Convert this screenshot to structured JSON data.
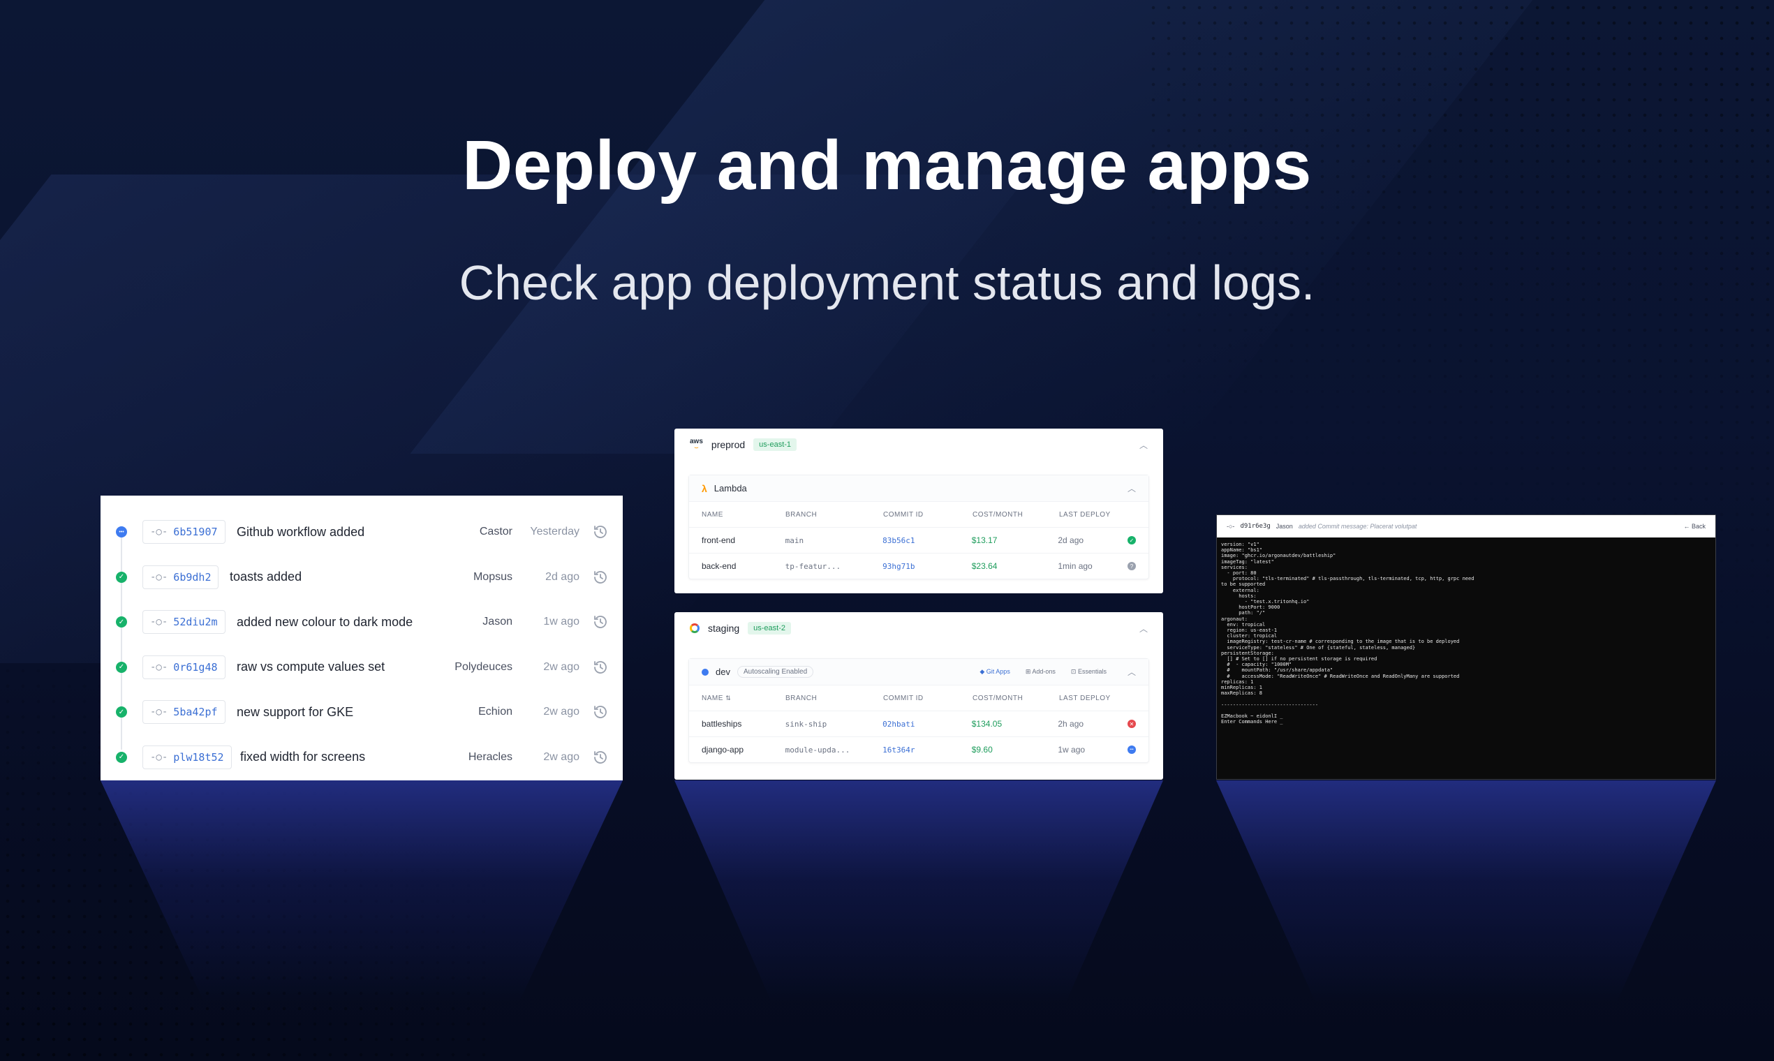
{
  "hero": {
    "title": "Deploy and manage apps",
    "subtitle": "Check app deployment status and logs."
  },
  "commits": [
    {
      "sha": "6b51907",
      "message": "Github workflow added",
      "author": "Castor",
      "time": "Yesterday",
      "status": "running"
    },
    {
      "sha": "6b9dh2",
      "message": "toasts added",
      "author": "Mopsus",
      "time": "2d ago",
      "status": "success"
    },
    {
      "sha": "52diu2m",
      "message": "added new colour to dark mode",
      "author": "Jason",
      "time": "1w ago",
      "status": "success"
    },
    {
      "sha": "0r61g48",
      "message": "raw vs compute values set",
      "author": "Polydeuces",
      "time": "2w ago",
      "status": "success"
    },
    {
      "sha": "5ba42pf",
      "message": "new support for GKE",
      "author": "Echion",
      "time": "2w ago",
      "status": "success"
    },
    {
      "sha": "plw18t52",
      "message": "fixed width for screens",
      "author": "Heracles",
      "time": "2w ago",
      "status": "success"
    }
  ],
  "environments": {
    "columns": {
      "name": "NAME",
      "branch": "BRANCH",
      "commit": "COMMIT ID",
      "cost": "COST/MONTH",
      "last": "LAST DEPLOY"
    },
    "preprod": {
      "provider": "aws",
      "name": "preprod",
      "region": "us-east-1",
      "group": "Lambda",
      "rows": [
        {
          "name": "front-end",
          "branch": "main",
          "commit": "83b56c1",
          "cost": "$13.17",
          "last": "2d ago",
          "status": "success"
        },
        {
          "name": "back-end",
          "branch": "tp-featur...",
          "commit": "93hg71b",
          "cost": "$23.64",
          "last": "1min ago",
          "status": "unknown"
        }
      ]
    },
    "staging": {
      "provider": "gcp",
      "name": "staging",
      "region": "us-east-2",
      "group": "dev",
      "autoscaling": "Autoscaling Enabled",
      "links": {
        "git": "Git Apps",
        "addons": "Add-ons",
        "essentials": "Essentials"
      },
      "rows": [
        {
          "name": "battleships",
          "branch": "sink-ship",
          "commit": "02hbati",
          "cost": "$134.05",
          "last": "2h ago",
          "status": "error"
        },
        {
          "name": "django-app",
          "branch": "module-upda...",
          "commit": "16t364r",
          "cost": "$9.60",
          "last": "1w ago",
          "status": "running"
        }
      ]
    }
  },
  "terminal": {
    "sha": "d91r6e3g",
    "author": "Jason",
    "note": "added Commit message: Placerat volutpat",
    "back": "Back",
    "log": "version: \"v1\"\nappName: \"bs1\"\nimage: \"ghcr.io/argonautdev/battleship\"\nimageTag: \"latest\"\nservices:\n  - port: 80\n    protocol: \"tls-terminated\" # tls-passthrough, tls-terminated, tcp, http, grpc need\nto be supported\n    external:\n      hosts:\n        - \"test.x.tritonhq.io\"\n      hostPort: 9000\n      path: \"/\"\nargonaut:\n  env: tropical\n  region: us-east-1\n  cluster: tropical\n  imageRegistry: test-cr-name # corresponding to the image that is to be deployed\n  serviceType: \"stateless\" # One of {stateful, stateless, managed}\npersistentStorage:\n  [] # Set to [] if no persistent storage is required\n  #  - capacity: \"1000M\"\n  #    mountPath: \"/usr/share/appdata\"\n  #    accessMode: \"ReadWriteOnce\" # ReadWriteOnce and ReadOnlyMany are supported\nreplicas: 1\nminReplicas: 1\nmaxReplicas: 8\n\n---------------------------------\n\nEZMacbook ~ eidonlI _\nEnter Commands Here _"
  },
  "colors": {
    "background": "#0a1330",
    "success": "#17b26a",
    "running": "#3e7bf0",
    "error": "#e5484d",
    "link": "#3b6fd4",
    "cost": "#1d9c5b"
  }
}
